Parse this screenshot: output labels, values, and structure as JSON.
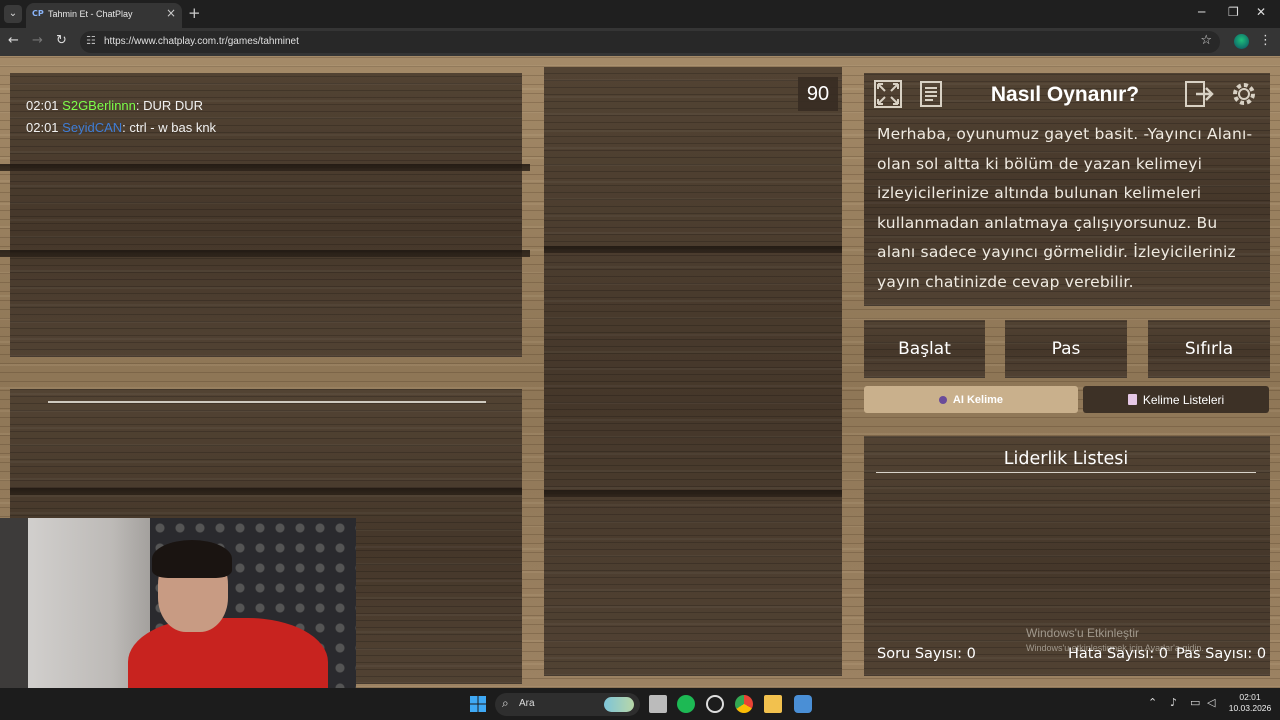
{
  "browser": {
    "tab_favicon": "CP",
    "tab_title": "Tahmin Et - ChatPlay",
    "url": "https://www.chatplay.com.tr/games/tahminet",
    "icons": [
      "back-icon",
      "forward-icon",
      "reload-icon",
      "site-info-icon",
      "bookmark-star-icon",
      "profile-avatar",
      "menu-kebab-icon"
    ]
  },
  "chat": {
    "messages": [
      {
        "time": "02:01",
        "user": "S2GBerlinnn",
        "text": ": DUR DUR",
        "color": "#7dff4a"
      },
      {
        "time": "02:01",
        "user": "SeyidCAN",
        "text": ": ctrl - w bas knk",
        "color": "#3f7dd6"
      }
    ]
  },
  "game": {
    "timer": "90",
    "how_to_title": "Nasıl Oynanır?",
    "how_to_text": "Merhaba, oyunumuz gayet basit. -Yayıncı Alanı- olan sol altta ki bölüm de yazan kelimeyi izleyicilerinize altında bulunan kelimeleri kullanmadan anlatmaya çalışıyorsunuz. Bu alanı sadece yayıncı görmelidir. İzleyicileriniz yayın chatinizde cevap verebilir.",
    "buttons": {
      "start": "Başlat",
      "pass": "Pas",
      "reset": "Sıfırla"
    },
    "ai_word": "AI Kelime",
    "word_lists": "Kelime Listeleri",
    "leaderboard_title": "Liderlik Listesi",
    "stats": {
      "questions": "Soru Sayısı: 0",
      "errors": "Hata Sayısı: 0",
      "passes": "Pas Sayısı: 0"
    }
  },
  "watermark": {
    "line1": "Windows'u Etkinleştir",
    "line2": "Windows'u etkinleştirmek için Ayarlar'a gidin."
  },
  "taskbar": {
    "search_label": "Ara",
    "time": "02:01",
    "date": "10.03.2026"
  }
}
